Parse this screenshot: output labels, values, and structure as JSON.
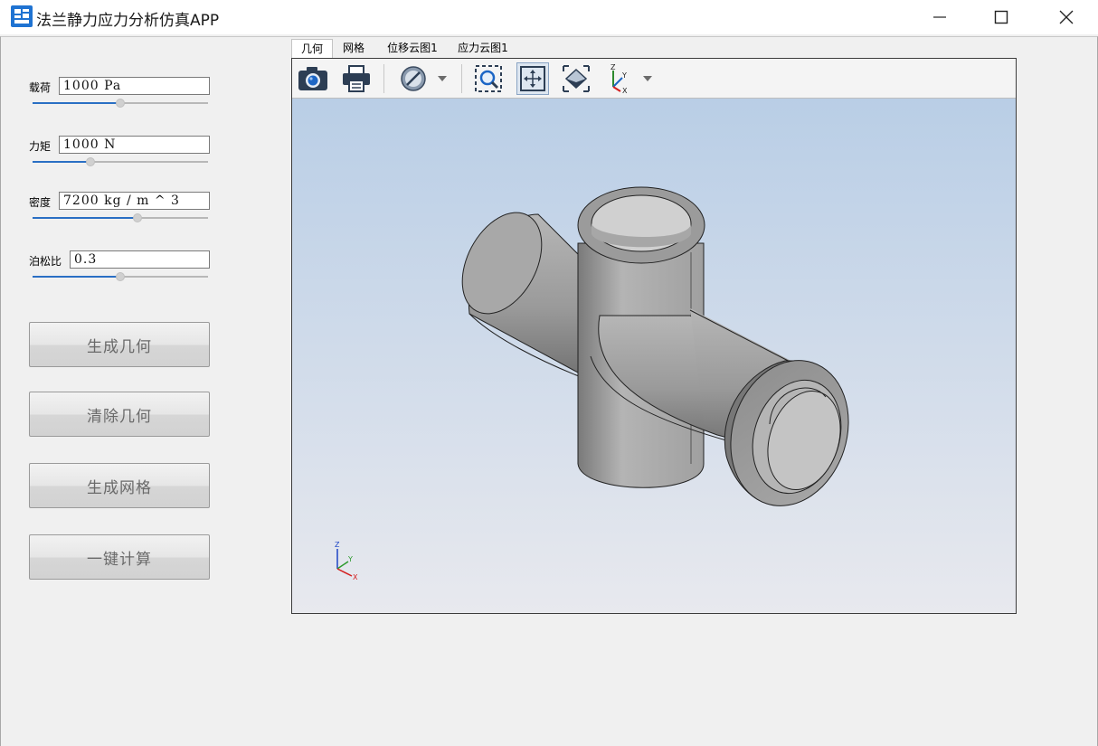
{
  "window": {
    "title": "法兰静力应力分析仿真APP",
    "controls": [
      "minimize-icon",
      "maximize-icon",
      "close-icon"
    ]
  },
  "params": [
    {
      "label": "载荷",
      "value": "1000 Pa",
      "slider_fraction": 0.5
    },
    {
      "label": "力矩",
      "value": "1000 N",
      "slider_fraction": 0.33
    },
    {
      "label": "密度",
      "value": "7200 kg / m ^ 3",
      "slider_fraction": 0.6
    },
    {
      "label": "泊松比",
      "value": "0.3",
      "slider_fraction": 0.5
    }
  ],
  "buttons": {
    "generate_geometry": "生成几何",
    "clear_geometry": "清除几何",
    "generate_mesh": "生成网格",
    "compute": "一键计算"
  },
  "tabs": [
    {
      "label": "几何",
      "active": true
    },
    {
      "label": "网格",
      "active": false
    },
    {
      "label": "位移云图1",
      "active": false
    },
    {
      "label": "应力云图1",
      "active": false
    }
  ],
  "toolbar": {
    "icons": [
      "camera-icon",
      "printer-icon",
      "hide-icon",
      "dropdown-arrow-icon",
      "zoom-box-icon",
      "zoom-extents-icon",
      "view-iso-icon",
      "axis-triad-icon",
      "dropdown-arrow-icon"
    ]
  },
  "triad": {
    "z": "Z",
    "y": "Y",
    "x": "X"
  },
  "colors": {
    "accent": "#2a6fc4",
    "viewport_top": "#b9cee6",
    "viewport_bottom": "#e8e9ee",
    "geometry": "#a6a6a6"
  }
}
